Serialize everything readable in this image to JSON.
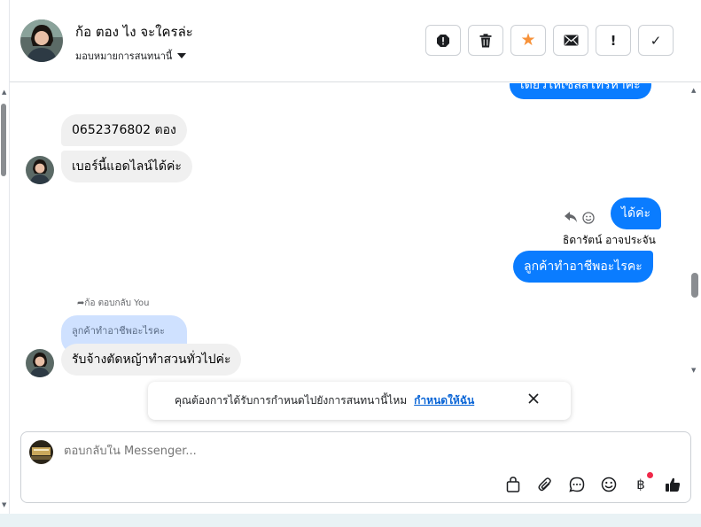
{
  "header": {
    "contact_name": "ก้อ ตอง ไง จะใครล่ะ",
    "assign_label": "มอบหมายการสนทนานี้"
  },
  "actions": [
    {
      "name": "report-icon",
      "glyph": "!"
    },
    {
      "name": "trash-icon",
      "glyph": ""
    },
    {
      "name": "star-icon",
      "glyph": "★"
    },
    {
      "name": "envelope-icon",
      "glyph": ""
    },
    {
      "name": "exclamation-icon",
      "glyph": "!"
    },
    {
      "name": "check-icon",
      "glyph": "✓"
    }
  ],
  "messages": {
    "top_partial_out": "เดี๋ยวให้เซลส์โทรหาค่ะ",
    "in_phone": "0652376802 ตอง",
    "in_admin_line": "เบอร์นี้แอดไลน์ได้ค่ะ",
    "out_ok": "ได้ค่ะ",
    "sender_name": "ธิดารัตน์ อาจประจัน",
    "out_question": "ลูกค้าทำอาชีพอะไรคะ",
    "reply_note": "ก้อ ตอบกลับ You",
    "quoted_text": "ลูกค้าทำอาชีพอะไรคะ",
    "in_reply": "รับจ้างตัดหญ้าทำสวนทั่วไปค่ะ"
  },
  "banner": {
    "text": "คุณต้องการได้รับการกำหนดไปยังการสนทนานี้ไหม",
    "link": "กำหนดให้ฉัน"
  },
  "composer": {
    "placeholder": "ตอบกลับใน Messenger..."
  },
  "colors": {
    "outgoing_bubble": "#0a7cff",
    "incoming_bubble": "#f0f0f0",
    "quote_bubble": "#cfe1ff",
    "star": "#f7923a",
    "link": "#0a65d6"
  }
}
